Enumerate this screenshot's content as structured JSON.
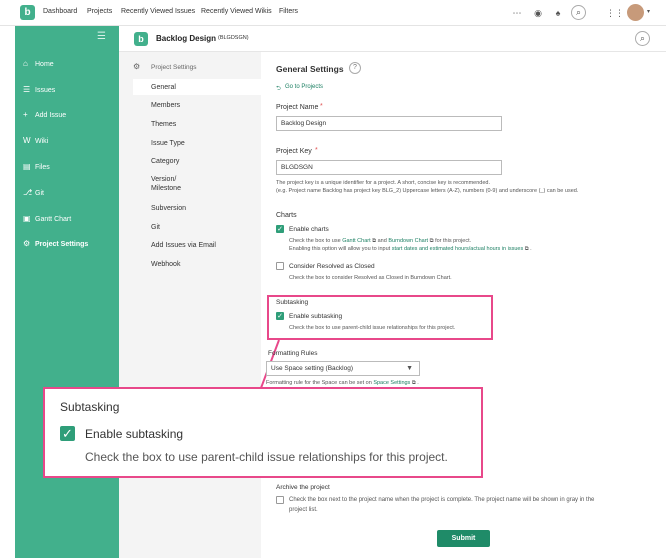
{
  "topbar": {
    "logo": "b",
    "nav": [
      "Dashboard",
      "Projects",
      "Recently Viewed Issues",
      "Recently Viewed Wikis",
      "Filters"
    ],
    "icons": [
      "more-icon",
      "eye-icon",
      "bell-icon",
      "search-icon",
      "apps-icon",
      "avatar"
    ]
  },
  "sidebar": {
    "items": [
      {
        "icon": "⌂",
        "label": "Home"
      },
      {
        "icon": "☰",
        "label": "Issues"
      },
      {
        "icon": "+",
        "label": "Add Issue"
      },
      {
        "icon": "W",
        "label": "Wiki"
      },
      {
        "icon": "▤",
        "label": "Files"
      },
      {
        "icon": "⎇",
        "label": "Git"
      },
      {
        "icon": "▣",
        "label": "Gantt Chart"
      },
      {
        "icon": "⚙",
        "label": "Project Settings"
      }
    ]
  },
  "project": {
    "logo": "b",
    "name": "Backlog Design",
    "key_badge": "(BLGDSGN)"
  },
  "settings_menu": {
    "title": "Project Settings",
    "items": [
      "General",
      "Members",
      "Themes",
      "Issue Type",
      "Category",
      "Version/",
      "Milestone",
      "Subversion",
      "Git",
      "Add Issues via Email",
      "Webhook"
    ]
  },
  "general": {
    "title": "General Settings",
    "help": "?",
    "back_link": "Go to Projects",
    "project_name_label": "Project Name",
    "project_name_value": "Backlog Design",
    "project_key_label": "Project Key",
    "project_key_value": "BLGDSGN",
    "key_help_1": "The project key is a unique identifier for a project. A short, concise key is recommended.",
    "key_help_2": "(e.g. Project name Backlog has project key BLG_2) Uppercase letters (A-Z), numbers (0-9) and underscore (_) can be used.",
    "required": "*"
  },
  "charts": {
    "heading": "Charts",
    "enable_label": "Enable charts",
    "help_1_pre": "Check the box to use",
    "gantt_link": "Gantt Chart",
    "and": "and",
    "burndown_link": "Burndown Chart",
    "help_1_post": "for this project.",
    "help_2_pre": "Enabling this option will allow you to input",
    "help_2_link": "start dates and estimated hours/actual hours in issues",
    "consider_label": "Consider Resolved as Closed",
    "consider_help": "Check the box to consider Resolved as Closed in Burndown Chart."
  },
  "subtasking": {
    "heading": "Subtasking",
    "enable_label": "Enable subtasking",
    "help": "Check the box to use parent-child issue relationships for this project."
  },
  "formatting": {
    "heading": "Formatting Rules",
    "select_value": "Use Space setting (Backlog)",
    "help_pre": "Formatting rule for the Space can be set on",
    "help_link": "Space Settings"
  },
  "archive": {
    "heading": "Archive the project",
    "help_1": "Check the box next to the project name when the project is complete. The project name will be shown in gray in the",
    "help_2": "project list."
  },
  "submit_label": "Submit",
  "colors": {
    "accent": "#42b08c",
    "callout": "#e8488a",
    "button": "#1f8b68"
  }
}
